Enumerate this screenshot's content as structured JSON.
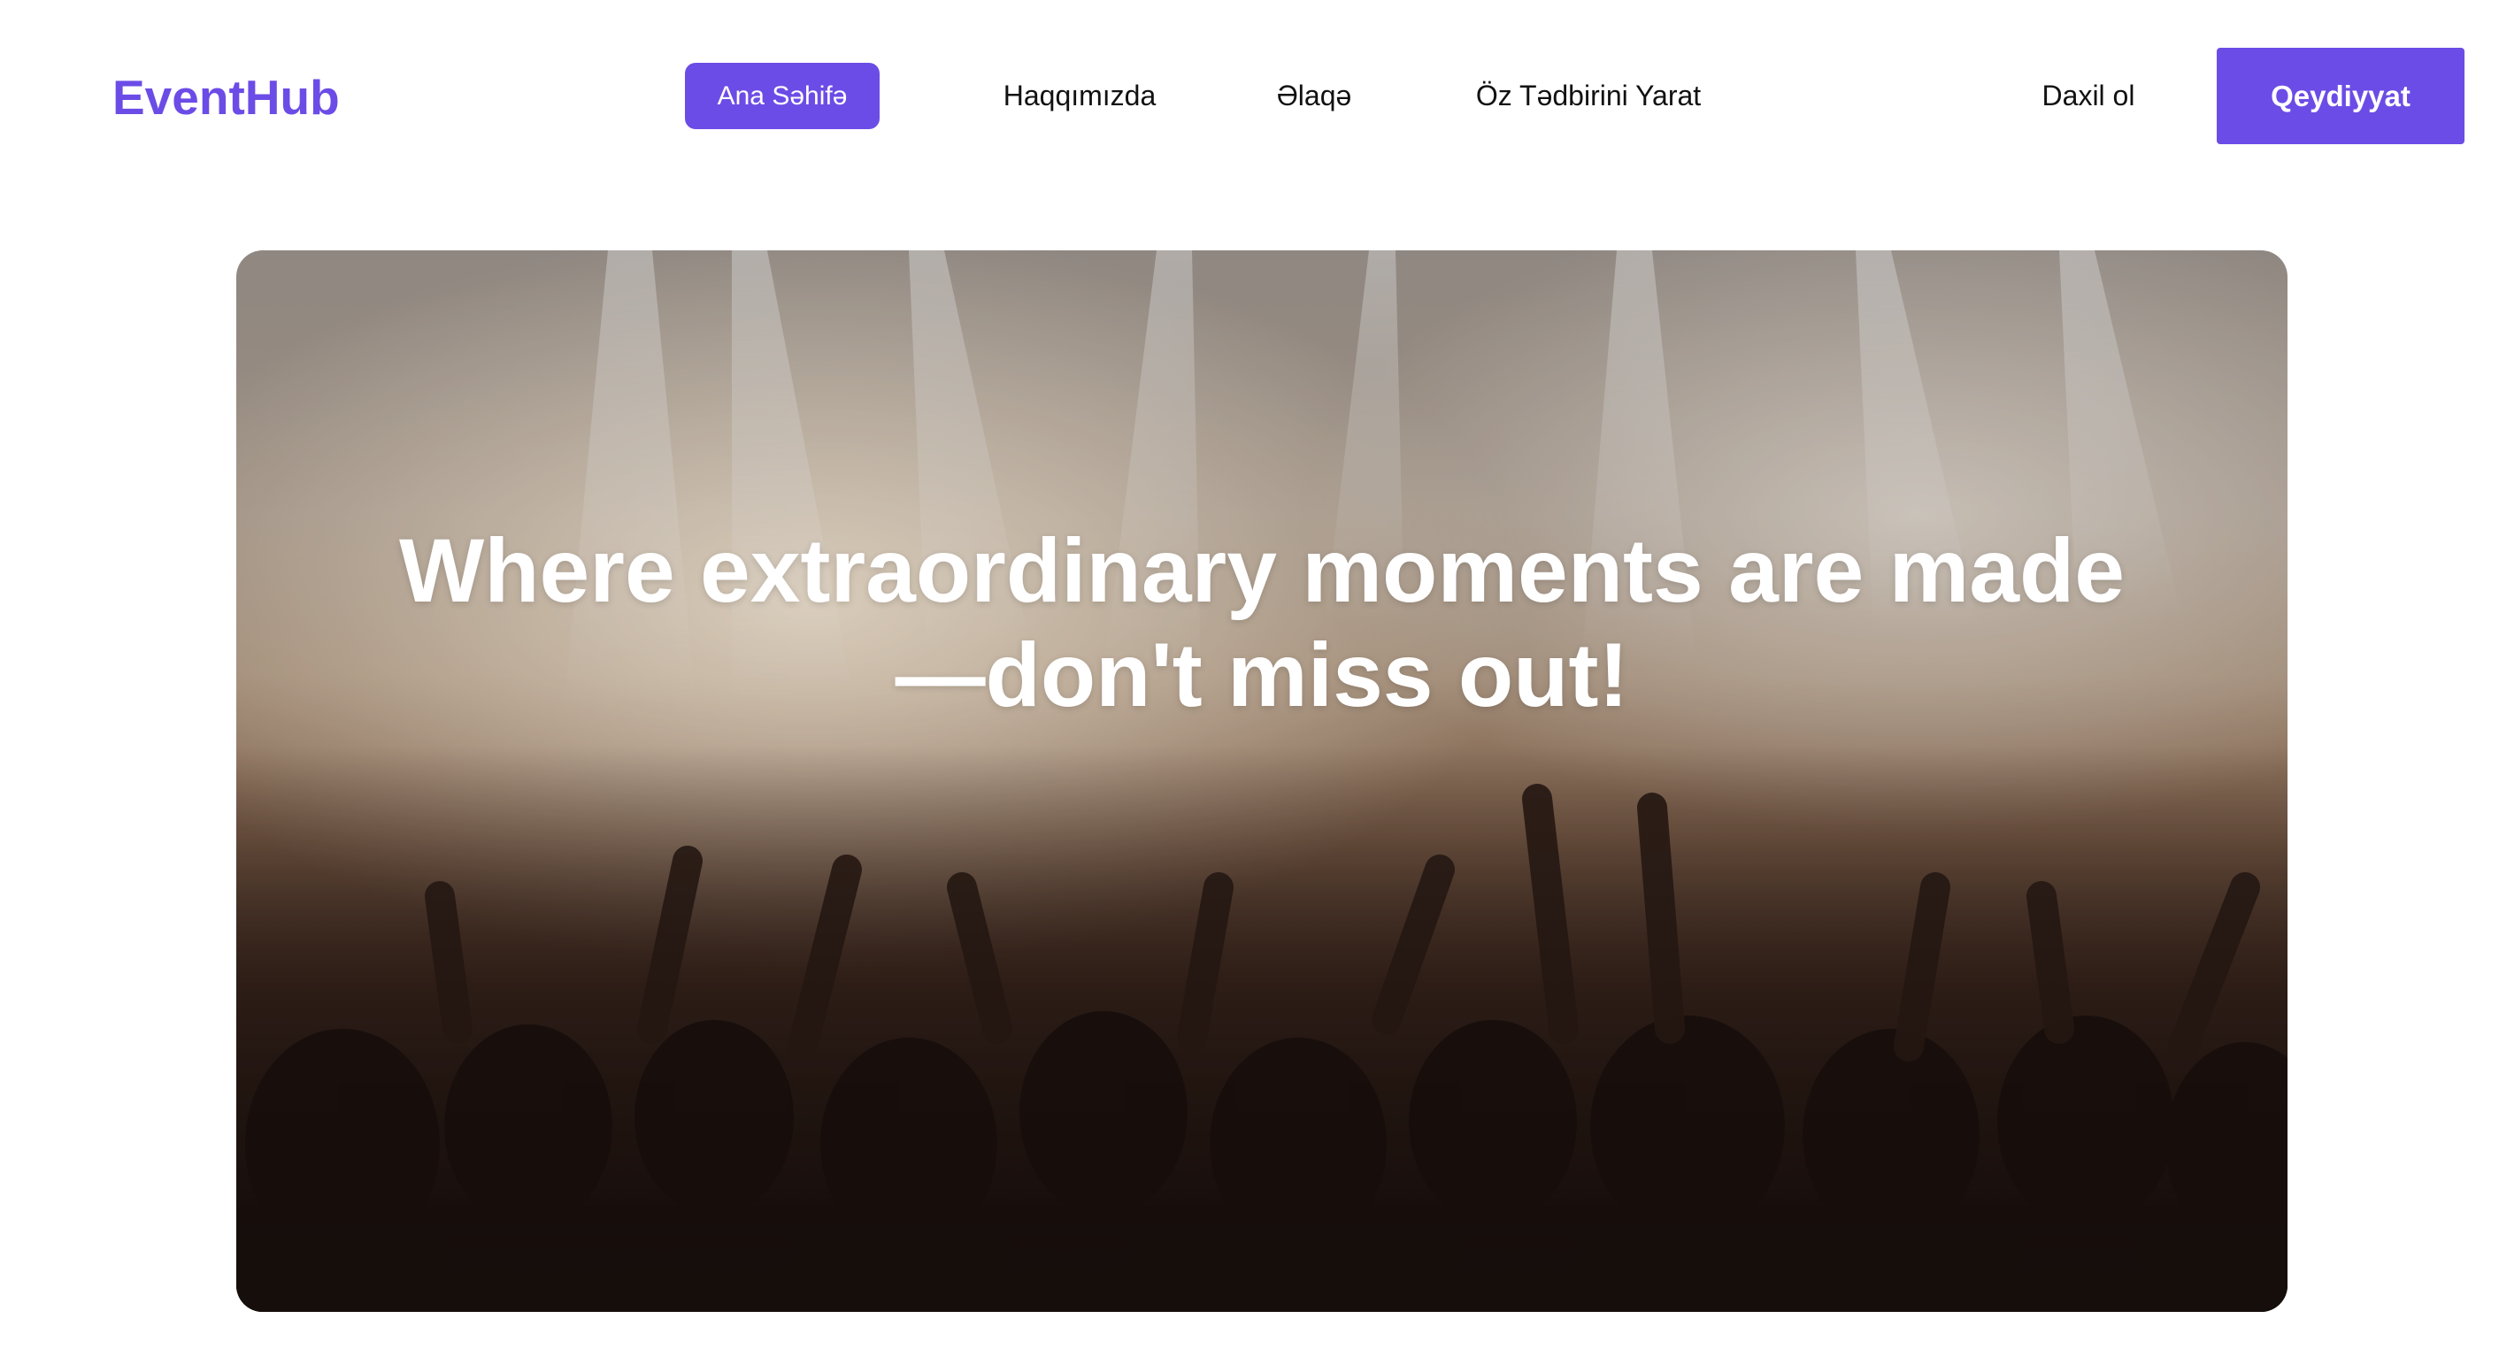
{
  "brand": {
    "logo_text": "EventHub",
    "accent_color": "#6C4CE6"
  },
  "nav": {
    "items": [
      {
        "label": "Ana Səhifə",
        "active": true
      },
      {
        "label": "Haqqımızda",
        "active": false
      },
      {
        "label": "Əlaqə",
        "active": false
      },
      {
        "label": "Öz Tədbirini Yarat",
        "active": false
      }
    ]
  },
  "auth": {
    "login_label": "Daxil ol",
    "register_label": "Qeydiyyat"
  },
  "hero": {
    "title": "Where extraordinary moments are made —don't miss out!",
    "image_subject": "concert-crowd-photo"
  }
}
